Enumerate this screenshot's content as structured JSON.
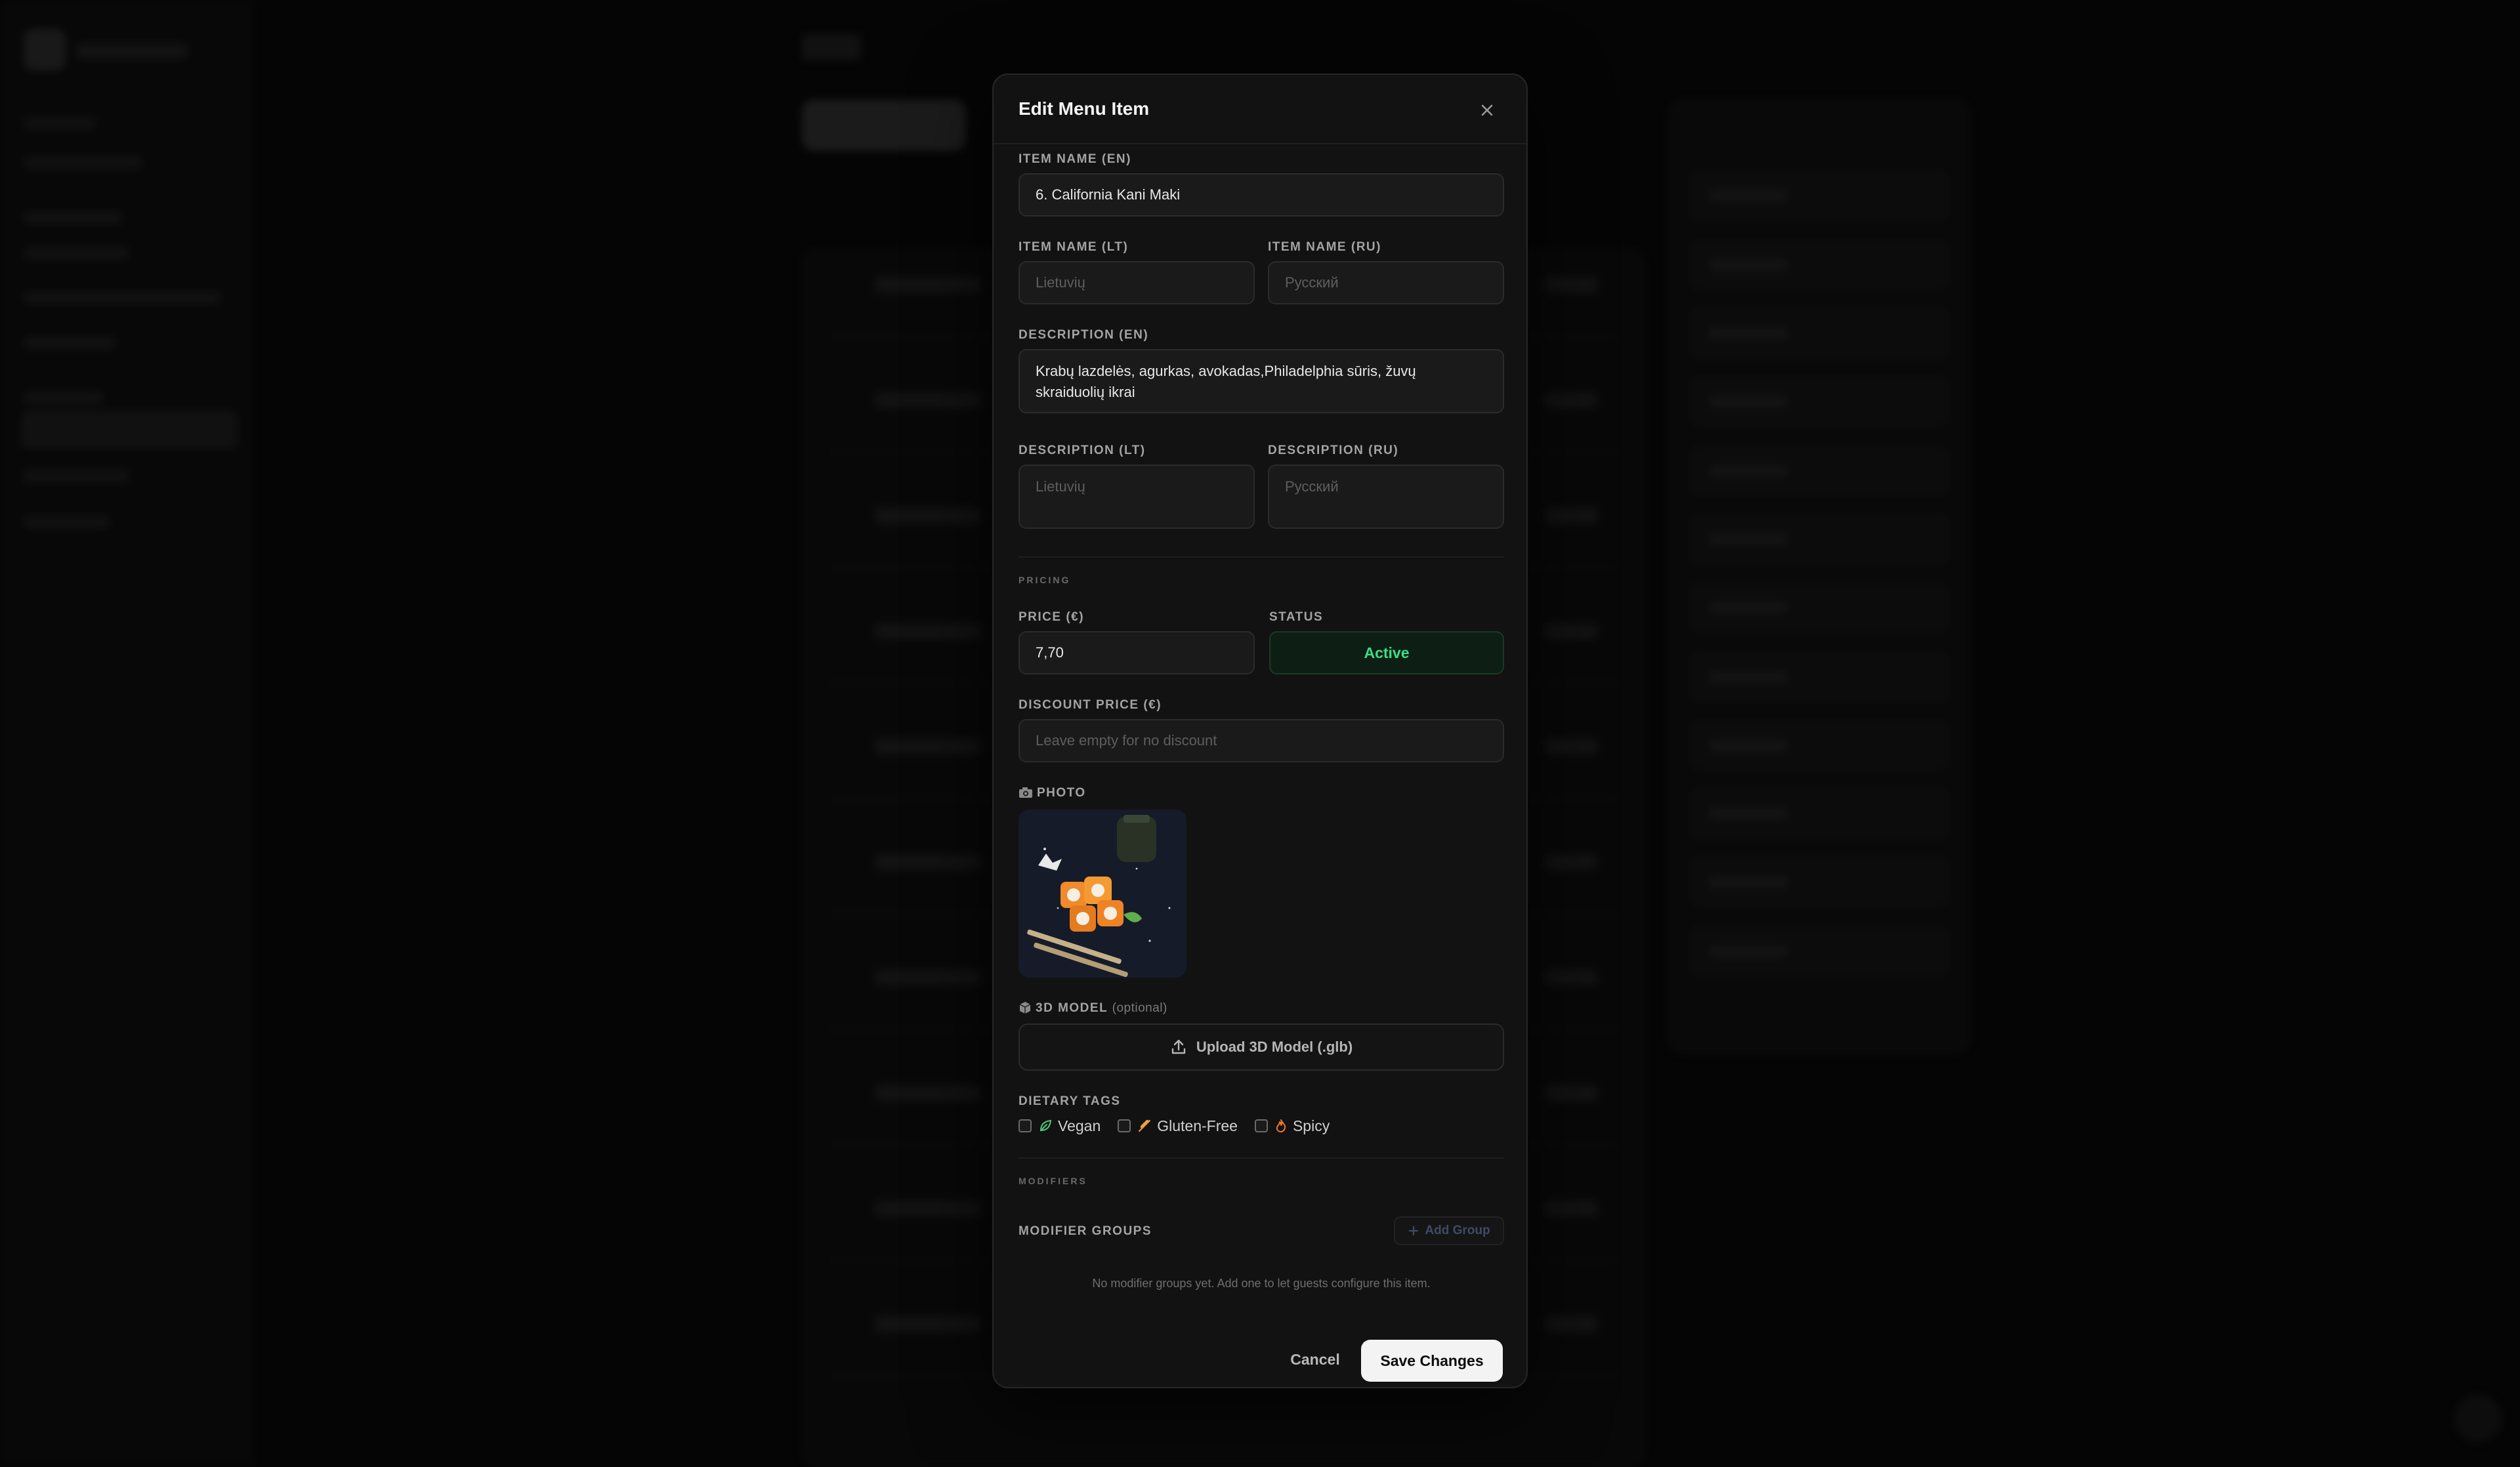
{
  "modal": {
    "title": "Edit Menu Item"
  },
  "fields": {
    "name_en": {
      "label": "ITEM NAME (EN)",
      "value": "6. California Kani Maki"
    },
    "name_lt": {
      "label": "ITEM NAME (LT)",
      "placeholder": "Lietuvių"
    },
    "name_ru": {
      "label": "ITEM NAME (RU)",
      "placeholder": "Русский"
    },
    "desc_en": {
      "label": "DESCRIPTION (EN)",
      "value": "Krabų lazdelės, agurkas, avokadas,Philadelphia sūris, žuvų skraiduolių ikrai"
    },
    "desc_lt": {
      "label": "DESCRIPTION (LT)",
      "placeholder": "Lietuvių"
    },
    "desc_ru": {
      "label": "DESCRIPTION (RU)",
      "placeholder": "Русский"
    }
  },
  "pricing": {
    "section": "PRICING",
    "price_label": "PRICE (€)",
    "price_value": "7,70",
    "status_label": "STATUS",
    "status_value": "Active",
    "discount_label": "DISCOUNT PRICE (€)",
    "discount_placeholder": "Leave empty for no discount"
  },
  "photo": {
    "label": "PHOTO",
    "icon": "camera-icon"
  },
  "model3d": {
    "label": "3D MODEL",
    "optional": "(optional)",
    "upload_label": "Upload 3D Model (.glb)"
  },
  "dietary": {
    "label": "DIETARY TAGS",
    "tags": [
      {
        "label": "Vegan",
        "icon": "leaf-icon",
        "checked": false
      },
      {
        "label": "Gluten-Free",
        "icon": "wheat-icon",
        "checked": false
      },
      {
        "label": "Spicy",
        "icon": "flame-icon",
        "checked": false
      }
    ]
  },
  "modifiers": {
    "section": "MODIFIERS",
    "groups_label": "MODIFIER GROUPS",
    "add_group": "Add Group",
    "empty_note": "No modifier groups yet. Add one to let guests configure this item."
  },
  "footer": {
    "cancel": "Cancel",
    "save": "Save Changes"
  },
  "colors": {
    "accent_active": "#3ddc84",
    "save_bg": "#f3f3f3",
    "modal_bg": "#121212"
  }
}
